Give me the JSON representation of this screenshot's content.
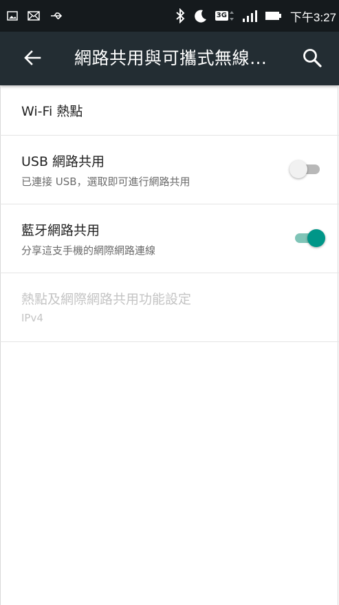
{
  "status_bar": {
    "time": "下午3:27",
    "network_badge": "3G",
    "icons": [
      "image-icon",
      "mail-icon",
      "usb-icon",
      "bluetooth-icon",
      "moon-icon",
      "signal-icon",
      "battery-icon"
    ]
  },
  "app_bar": {
    "title": "網路共用與可攜式無線…",
    "back_icon": "arrow-left-icon",
    "search_icon": "search-icon"
  },
  "items": [
    {
      "title": "Wi-Fi 熱點"
    },
    {
      "title": "USB 網路共用",
      "subtitle": "已連接 USB，選取即可進行網路共用",
      "switch_on": false
    },
    {
      "title": "藍牙網路共用",
      "subtitle": "分享這支手機的網際網路連線",
      "switch_on": true
    },
    {
      "title": "熱點及網際網路共用功能設定",
      "subtitle": "IPv4",
      "enabled": false
    }
  ],
  "colors": {
    "status_bar_bg": "#151a1d",
    "app_bar_bg": "#232d33",
    "accent": "#009688"
  }
}
